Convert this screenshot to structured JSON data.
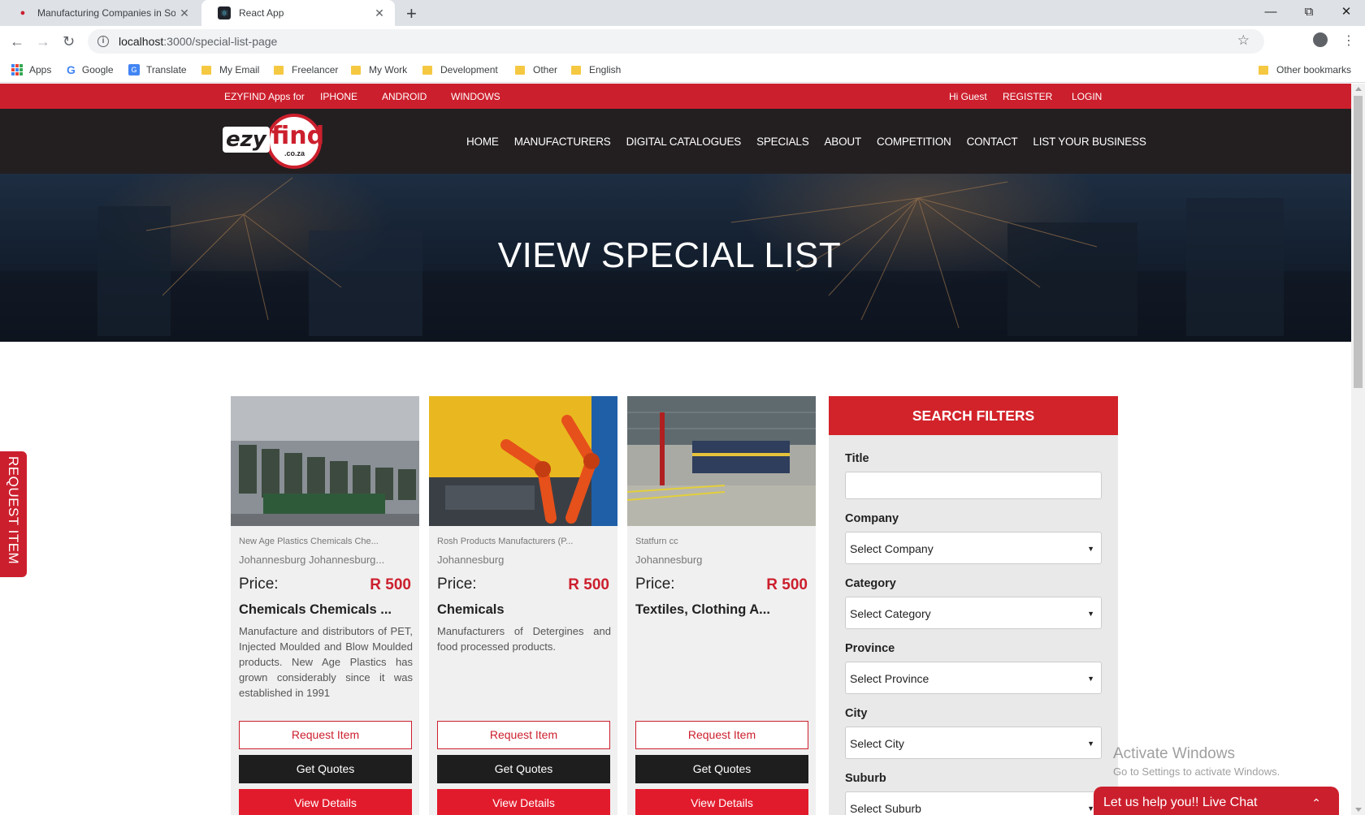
{
  "browser": {
    "tabs": [
      {
        "title": "Manufacturing Companies in Sou",
        "favicon": "ezyfind-favicon"
      },
      {
        "title": "React App",
        "favicon": "react-favicon"
      }
    ],
    "new_tab": "+",
    "url_host": "localhost",
    "url_path": ":3000/special-list-page",
    "bookmarks": [
      "Apps",
      "Google",
      "Translate",
      "My Email",
      "Freelancer",
      "My Work",
      "Development",
      "Other",
      "English"
    ],
    "other_bookmarks": "Other bookmarks"
  },
  "topstrip": {
    "apps_for": "EZYFIND Apps for",
    "iphone": "IPHONE",
    "android": "ANDROID",
    "windows": "WINDOWS",
    "greeting": "Hi Guest",
    "register": "REGISTER",
    "login": "LOGIN"
  },
  "logo": {
    "part1": "ezy",
    "part2": "find",
    "part3": ".co.za"
  },
  "menu": [
    "HOME",
    "MANUFACTURERS",
    "DIGITAL CATALOGUES",
    "SPECIALS",
    "ABOUT",
    "COMPETITION",
    "CONTACT",
    "LIST YOUR BUSINESS"
  ],
  "hero": {
    "title": "VIEW SPECIAL LIST"
  },
  "cards": [
    {
      "company": "New Age Plastics Chemicals Che...",
      "city": "Johannesburg Johannesburg...",
      "price_label": "Price:",
      "price": "R 500",
      "title": "Chemicals Chemicals ...",
      "description": "Manufacture and distributors of PET, Injected Moulded and Blow Moulded products. New Age Plastics has grown considerably since it was established in 1991",
      "request": "Request Item",
      "quotes": "Get Quotes",
      "details": "View Details"
    },
    {
      "company": "Rosh Products Manufacturers (P...",
      "city": "Johannesburg",
      "price_label": "Price:",
      "price": "R 500",
      "title": "Chemicals",
      "description": "Manufacturers of Detergines and food processed products.",
      "request": "Request Item",
      "quotes": "Get Quotes",
      "details": "View Details"
    },
    {
      "company": "Statfurn cc",
      "city": "Johannesburg",
      "price_label": "Price:",
      "price": "R 500",
      "title": "Textiles, Clothing A...",
      "description": "",
      "request": "Request Item",
      "quotes": "Get Quotes",
      "details": "View Details"
    }
  ],
  "filters": {
    "heading": "SEARCH FILTERS",
    "title_label": "Title",
    "title_value": "",
    "company_label": "Company",
    "company_value": "Select Company",
    "category_label": "Category",
    "category_value": "Select Category",
    "province_label": "Province",
    "province_value": "Select Province",
    "city_label": "City",
    "city_value": "Select City",
    "suburb_label": "Suburb",
    "suburb_value": "Select Suburb"
  },
  "request_tab": "REQUEST ITEM",
  "watermark": {
    "line1": "Activate Windows",
    "line2": "Go to Settings to activate Windows."
  },
  "livechat": "Let us help you!! Live Chat",
  "colors": {
    "brand_red": "#cc1f2d",
    "nav_dark": "#231f20",
    "button_dark": "#1e1e1e"
  }
}
